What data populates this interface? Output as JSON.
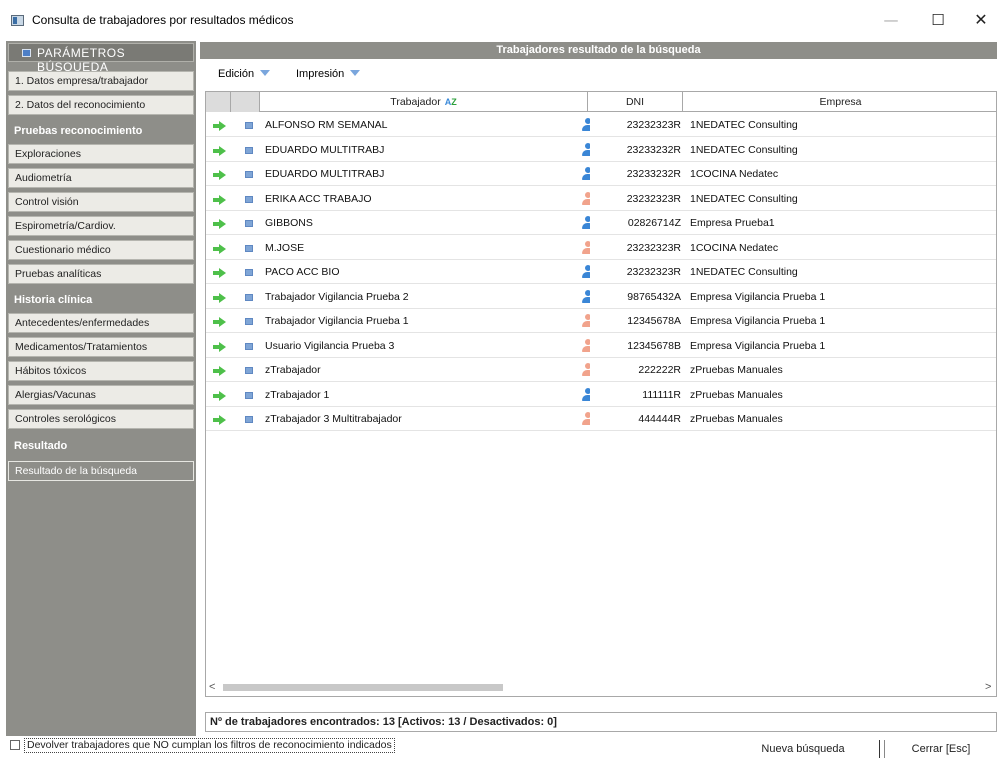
{
  "window": {
    "title": "Consulta de trabajadores por resultados médicos",
    "minimize": "—",
    "maximize": "☐",
    "close": "✕"
  },
  "left_panel": {
    "header": "PARÁMETROS BÚSQUEDA",
    "items_top": [
      "1. Datos empresa/trabajador",
      "2. Datos del reconocimiento"
    ],
    "section_pruebas": "Pruebas reconocimiento",
    "items_pruebas": [
      "Exploraciones",
      "Audiometría",
      "Control visión",
      "Espirometría/Cardiov.",
      "Cuestionario médico",
      "Pruebas analíticas"
    ],
    "section_historia": "Historia clínica",
    "items_historia": [
      "Antecedentes/enfermedades",
      "Medicamentos/Tratamientos",
      "Hábitos tóxicos",
      "Alergias/Vacunas",
      "Controles serológicos"
    ],
    "section_resultado": "Resultado",
    "items_resultado": [
      "Resultado de la búsqueda"
    ]
  },
  "main": {
    "header": "Trabajadores resultado de la búsqueda",
    "menu": {
      "edicion": "Edición",
      "impresion": "Impresión"
    },
    "columns": {
      "trabajador": "Trabajador",
      "dni": "DNI",
      "empresa": "Empresa"
    },
    "sort_icon_top": "A",
    "sort_icon_bottom": "Z",
    "rows": [
      {
        "name": "ALFONSO RM SEMANAL",
        "gender": "m",
        "dni": "23232323R",
        "empresa": "1NEDATEC Consulting"
      },
      {
        "name": "EDUARDO MULTITRABJ",
        "gender": "m",
        "dni": "23233232R",
        "empresa": "1NEDATEC Consulting"
      },
      {
        "name": "EDUARDO MULTITRABJ",
        "gender": "m",
        "dni": "23233232R",
        "empresa": "1COCINA Nedatec"
      },
      {
        "name": "ERIKA ACC TRABAJO",
        "gender": "f",
        "dni": "23232323R",
        "empresa": "1NEDATEC Consulting"
      },
      {
        "name": "GIBBONS",
        "gender": "m",
        "dni": "02826714Z",
        "empresa": "Empresa Prueba1"
      },
      {
        "name": "M.JOSE",
        "gender": "f",
        "dni": "23232323R",
        "empresa": "1COCINA Nedatec"
      },
      {
        "name": "PACO ACC BIO",
        "gender": "m",
        "dni": "23232323R",
        "empresa": "1NEDATEC Consulting"
      },
      {
        "name": "Trabajador Vigilancia Prueba 2",
        "gender": "m",
        "dni": "98765432A",
        "empresa": "Empresa Vigilancia Prueba 1"
      },
      {
        "name": "Trabajador Vigilancia Prueba 1",
        "gender": "f",
        "dni": "12345678A",
        "empresa": "Empresa Vigilancia Prueba 1"
      },
      {
        "name": "Usuario Vigilancia Prueba 3",
        "gender": "f",
        "dni": "12345678B",
        "empresa": "Empresa Vigilancia Prueba 1"
      },
      {
        "name": "zTrabajador",
        "gender": "f",
        "dni": "222222R",
        "empresa": "zPruebas Manuales"
      },
      {
        "name": "zTrabajador 1",
        "gender": "m",
        "dni": "111111R",
        "empresa": "zPruebas Manuales"
      },
      {
        "name": "zTrabajador 3 Multitrabajador",
        "gender": "f",
        "dni": "444444R",
        "empresa": "zPruebas Manuales"
      }
    ],
    "scroll_left": "<",
    "scroll_right": ">",
    "status": "Nº de trabajadores encontrados: 13  [Activos: 13 / Desactivados: 0]"
  },
  "bottom": {
    "checkbox_label": "Devolver trabajadores que NO cumplan los filtros de reconocimiento indicados",
    "nueva_busqueda": "Nueva búsqueda",
    "cerrar": "Cerrar [Esc]"
  },
  "colors": {
    "panel_gray": "#8e8e89",
    "arrow_green": "#4ec04a",
    "male_blue": "#3a86d6",
    "female_salmon": "#f1a38c"
  }
}
